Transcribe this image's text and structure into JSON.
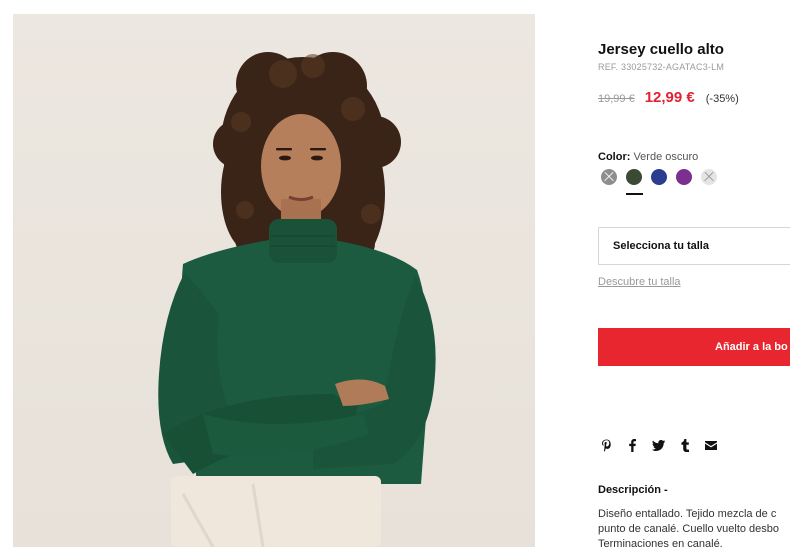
{
  "product": {
    "title": "Jersey cuello alto",
    "ref": "REF. 33025732-AGATAC3-LM",
    "old_price": "19,99 €",
    "price": "12,99 €",
    "discount": "(-35%)"
  },
  "color": {
    "label": "Color:",
    "value": "Verde oscuro",
    "swatches": [
      {
        "name": "gris",
        "hex": "#8e8e8e",
        "available": false
      },
      {
        "name": "verde oscuro",
        "hex": "#3a4a33",
        "available": true,
        "selected": true
      },
      {
        "name": "azul",
        "hex": "#2b3d8f",
        "available": true
      },
      {
        "name": "morado",
        "hex": "#7b2f8e",
        "available": true
      },
      {
        "name": "blanco",
        "hex": "#e4e4e4",
        "available": false
      }
    ]
  },
  "size": {
    "placeholder": "Selecciona tu talla",
    "guide_link": "Descubre tu talla"
  },
  "cart": {
    "add_label": "Añadir a la bo"
  },
  "share": {
    "icons": [
      "pinterest-icon",
      "facebook-icon",
      "twitter-icon",
      "tumblr-icon",
      "email-icon"
    ]
  },
  "description": {
    "title": "Descripción -",
    "lines": [
      "Diseño entallado. Tejido mezcla de c",
      "punto de canalé. Cuello vuelto desbo",
      "Terminaciones en canalé."
    ]
  },
  "colors": {
    "accent": "#e8262f",
    "sale": "#e22134"
  }
}
